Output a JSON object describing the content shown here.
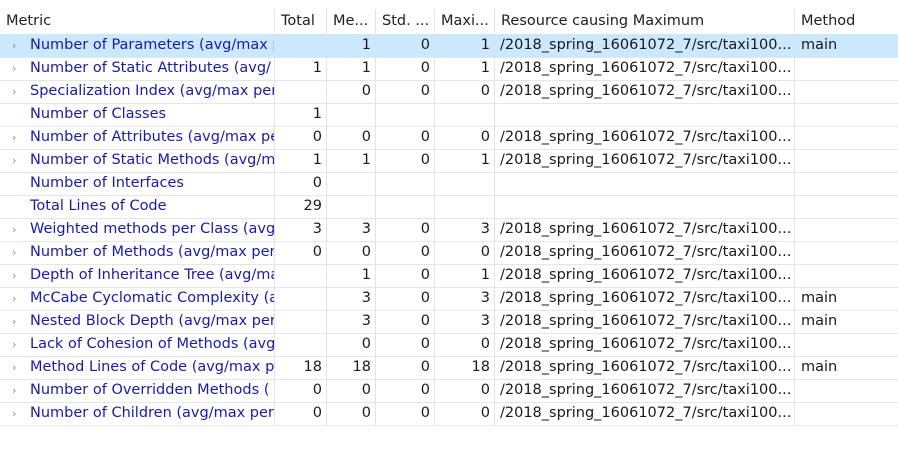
{
  "columns": [
    "Metric",
    "Total",
    "Me...",
    "Std. ...",
    "Maxi...",
    "Resource causing Maximum",
    "Method"
  ],
  "twisty_glyph": "›",
  "rows": [
    {
      "metric": "Number of Parameters (avg/max p",
      "total": "",
      "mean": "1",
      "std": "0",
      "max": "1",
      "resource": "/2018_spring_16061072_7/src/taxi100...",
      "method": "main",
      "expandable": true,
      "selected": true
    },
    {
      "metric": "Number of Static Attributes (avg/",
      "total": "1",
      "mean": "1",
      "std": "0",
      "max": "1",
      "resource": "/2018_spring_16061072_7/src/taxi100...",
      "method": "",
      "expandable": true
    },
    {
      "metric": "Specialization Index (avg/max per",
      "total": "",
      "mean": "0",
      "std": "0",
      "max": "0",
      "resource": "/2018_spring_16061072_7/src/taxi100...",
      "method": "",
      "expandable": true
    },
    {
      "metric": "Number of Classes",
      "total": "1",
      "mean": "",
      "std": "",
      "max": "",
      "resource": "",
      "method": "",
      "expandable": false
    },
    {
      "metric": "Number of Attributes (avg/max pe",
      "total": "0",
      "mean": "0",
      "std": "0",
      "max": "0",
      "resource": "/2018_spring_16061072_7/src/taxi100...",
      "method": "",
      "expandable": true
    },
    {
      "metric": "Number of Static Methods (avg/m",
      "total": "1",
      "mean": "1",
      "std": "0",
      "max": "1",
      "resource": "/2018_spring_16061072_7/src/taxi100...",
      "method": "",
      "expandable": true
    },
    {
      "metric": "Number of Interfaces",
      "total": "0",
      "mean": "",
      "std": "",
      "max": "",
      "resource": "",
      "method": "",
      "expandable": false
    },
    {
      "metric": "Total Lines of Code",
      "total": "29",
      "mean": "",
      "std": "",
      "max": "",
      "resource": "",
      "method": "",
      "expandable": false
    },
    {
      "metric": "Weighted methods per Class (avg",
      "total": "3",
      "mean": "3",
      "std": "0",
      "max": "3",
      "resource": "/2018_spring_16061072_7/src/taxi100...",
      "method": "",
      "expandable": true
    },
    {
      "metric": "Number of Methods (avg/max per",
      "total": "0",
      "mean": "0",
      "std": "0",
      "max": "0",
      "resource": "/2018_spring_16061072_7/src/taxi100...",
      "method": "",
      "expandable": true
    },
    {
      "metric": "Depth of Inheritance Tree (avg/ma",
      "total": "",
      "mean": "1",
      "std": "0",
      "max": "1",
      "resource": "/2018_spring_16061072_7/src/taxi100...",
      "method": "",
      "expandable": true
    },
    {
      "metric": "McCabe Cyclomatic Complexity (a",
      "total": "",
      "mean": "3",
      "std": "0",
      "max": "3",
      "resource": "/2018_spring_16061072_7/src/taxi100...",
      "method": "main",
      "expandable": true
    },
    {
      "metric": "Nested Block Depth (avg/max per",
      "total": "",
      "mean": "3",
      "std": "0",
      "max": "3",
      "resource": "/2018_spring_16061072_7/src/taxi100...",
      "method": "main",
      "expandable": true
    },
    {
      "metric": "Lack of Cohesion of Methods (avg",
      "total": "",
      "mean": "0",
      "std": "0",
      "max": "0",
      "resource": "/2018_spring_16061072_7/src/taxi100...",
      "method": "",
      "expandable": true
    },
    {
      "metric": "Method Lines of Code (avg/max p",
      "total": "18",
      "mean": "18",
      "std": "0",
      "max": "18",
      "resource": "/2018_spring_16061072_7/src/taxi100...",
      "method": "main",
      "expandable": true
    },
    {
      "metric": "Number of Overridden Methods (",
      "total": "0",
      "mean": "0",
      "std": "0",
      "max": "0",
      "resource": "/2018_spring_16061072_7/src/taxi100...",
      "method": "",
      "expandable": true
    },
    {
      "metric": "Number of Children (avg/max per",
      "total": "0",
      "mean": "0",
      "std": "0",
      "max": "0",
      "resource": "/2018_spring_16061072_7/src/taxi100...",
      "method": "",
      "expandable": true
    }
  ]
}
